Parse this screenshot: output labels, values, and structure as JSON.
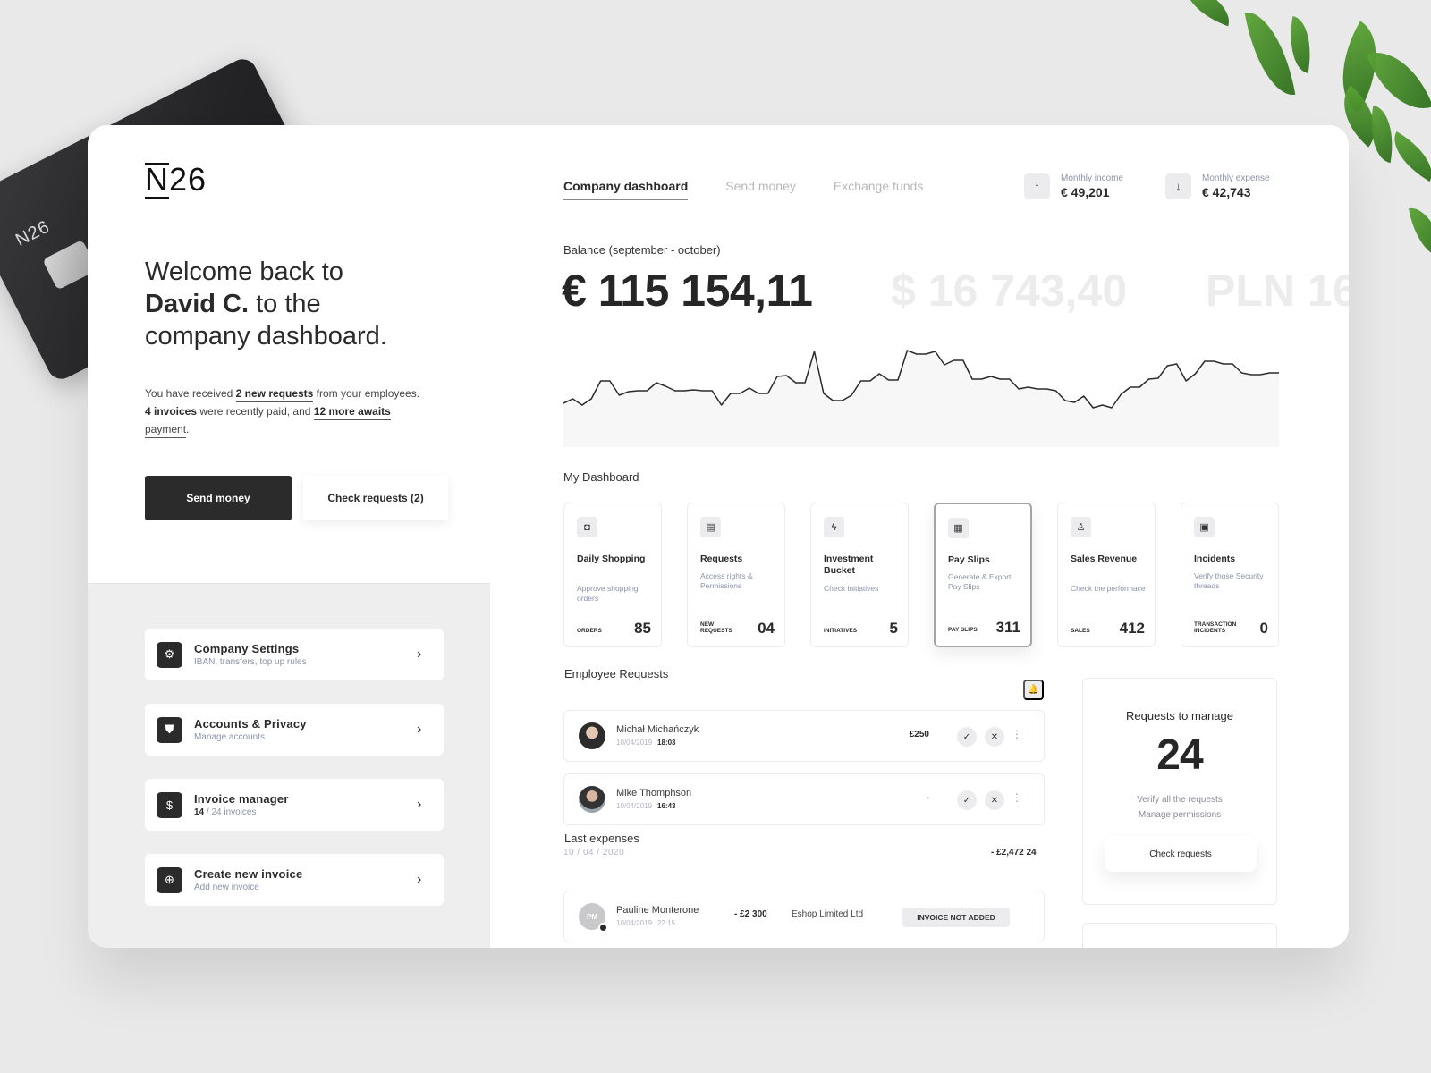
{
  "brand": {
    "logo_text": "26",
    "logo_letter": "N",
    "card_logo": "N26"
  },
  "left": {
    "welcome": {
      "line1": "Welcome back to",
      "name": "David C.",
      "line2_rest": " to the",
      "line3": "company dashboard."
    },
    "intro": {
      "p1": "You have received ",
      "link1": "2 new requests",
      "p2": " from your employees.",
      "bold1": "4 invoices",
      "p3": " were recently paid, and ",
      "link2": "12 more awaits",
      "link3": "payment",
      "p4": "."
    },
    "buttons": {
      "send_money": "Send money",
      "check_requests": "Check requests (2)"
    },
    "menu": [
      {
        "title": "Company Settings",
        "sub": "IBAN, transfers, top up rules",
        "icon": "gear-icon",
        "glyph": "⚙"
      },
      {
        "title": "Accounts & Privacy",
        "sub": "Manage accounts",
        "icon": "shield-icon",
        "glyph": "⛊"
      },
      {
        "title": "Invoice manager",
        "sub_bold": "14",
        "sub": " / 24 invoices",
        "icon": "invoice-icon",
        "glyph": "$"
      },
      {
        "title": "Create new invoice",
        "sub": "Add new invoice",
        "icon": "plus-circle-icon",
        "glyph": "⊕"
      }
    ],
    "chevron": "›"
  },
  "header": {
    "tabs": [
      {
        "label": "Company dashboard",
        "active": true
      },
      {
        "label": "Send money",
        "active": false
      },
      {
        "label": "Exchange funds",
        "active": false
      }
    ],
    "stats": [
      {
        "label": "Monthly income",
        "value": "€ 49,201",
        "icon": "arrow-up-icon",
        "glyph": "↑"
      },
      {
        "label": "Monthly expense",
        "value": "€ 42,743",
        "icon": "arrow-down-icon",
        "glyph": "↓"
      }
    ]
  },
  "balance": {
    "label": "Balance (september - october)",
    "main": "€ 115 154,11",
    "usd": "$ 16 743,40",
    "pln": "PLN 16"
  },
  "chart_data": {
    "type": "area",
    "title": "Balance (september - october)",
    "xlabel": "",
    "ylabel": "",
    "grid": false,
    "ylim": [
      0,
      100
    ],
    "values": [
      39,
      44,
      37,
      44,
      64,
      64,
      48,
      52,
      53,
      53,
      62,
      58,
      53,
      53,
      54,
      53,
      53,
      37,
      50,
      50,
      56,
      50,
      50,
      69,
      70,
      62,
      62,
      97,
      50,
      42,
      42,
      48,
      64,
      64,
      72,
      65,
      65,
      98,
      94,
      94,
      97,
      82,
      87,
      87,
      66,
      66,
      69,
      66,
      66,
      55,
      57,
      55,
      55,
      53,
      42,
      40,
      47,
      34,
      37,
      34,
      49,
      57,
      57,
      66,
      67,
      81,
      83,
      64,
      72,
      86,
      86,
      83,
      83,
      73,
      71,
      71,
      73,
      73
    ]
  },
  "dashboard": {
    "title": "My Dashboard",
    "cards": [
      {
        "title": "Daily Shopping",
        "sub": "Approve shopping orders",
        "metric": "ORDERS",
        "value": "85",
        "icon": "shopping-bag-icon",
        "glyph": "◘",
        "active": false
      },
      {
        "title": "Requests",
        "sub": "Access rights & Permissions",
        "metric": "NEW REQUESTS",
        "value": "04",
        "icon": "document-icon",
        "glyph": "▤",
        "active": false
      },
      {
        "title": "Investment Bucket",
        "sub": "Check initiatives",
        "metric": "INITIATIVES",
        "value": "5",
        "icon": "lightning-icon",
        "glyph": "ϟ",
        "active": false
      },
      {
        "title": "Pay Slips",
        "sub": "Generate & Export Pay Slips",
        "metric": "PAY SLIPS",
        "value": "311",
        "icon": "file-text-icon",
        "glyph": "▦",
        "active": true
      },
      {
        "title": "Sales Revenue",
        "sub": "Check the performace",
        "metric": "SALES",
        "value": "412",
        "icon": "user-icon",
        "glyph": "♙",
        "active": false
      },
      {
        "title": "Incidents",
        "sub": "Verify those Security threads",
        "metric": "TRANSACTION INCIDENTS",
        "value": "0",
        "icon": "archive-icon",
        "glyph": "▣",
        "active": false
      }
    ]
  },
  "employee_requests": {
    "title": "Employee Requests",
    "bell_glyph": "🔔",
    "rows": [
      {
        "name": "Michał Michańczyk",
        "date": "10/04/2019",
        "time": "18:03",
        "amount": "£250"
      },
      {
        "name": "Mike Thomphson",
        "date": "10/04/2019",
        "time": "16:43",
        "amount": "-"
      }
    ],
    "approve_glyph": "✓",
    "reject_glyph": "✕",
    "more_glyph": "⋮"
  },
  "last_expenses": {
    "title": "Last expenses",
    "date": "10 / 04 / 2020",
    "total": "- £2,472 24",
    "rows": [
      {
        "initials": "PM",
        "name": "Pauline Monterone",
        "date": "10/04/2019",
        "time": "22:15",
        "amount": "- £2 300",
        "merchant": "Eshop Limited Ltd",
        "status": "INVOICE NOT ADDED"
      }
    ]
  },
  "requests_panel": {
    "title": "Requests to manage",
    "count": "24",
    "line1": "Verify all the requests",
    "line2": "Manage permissions",
    "button": "Check requests"
  },
  "colors": {
    "dark": "#2b2b2b",
    "muted": "#8a93a8",
    "faded": "#ececed",
    "chart_fill": "#f7f7f8"
  }
}
